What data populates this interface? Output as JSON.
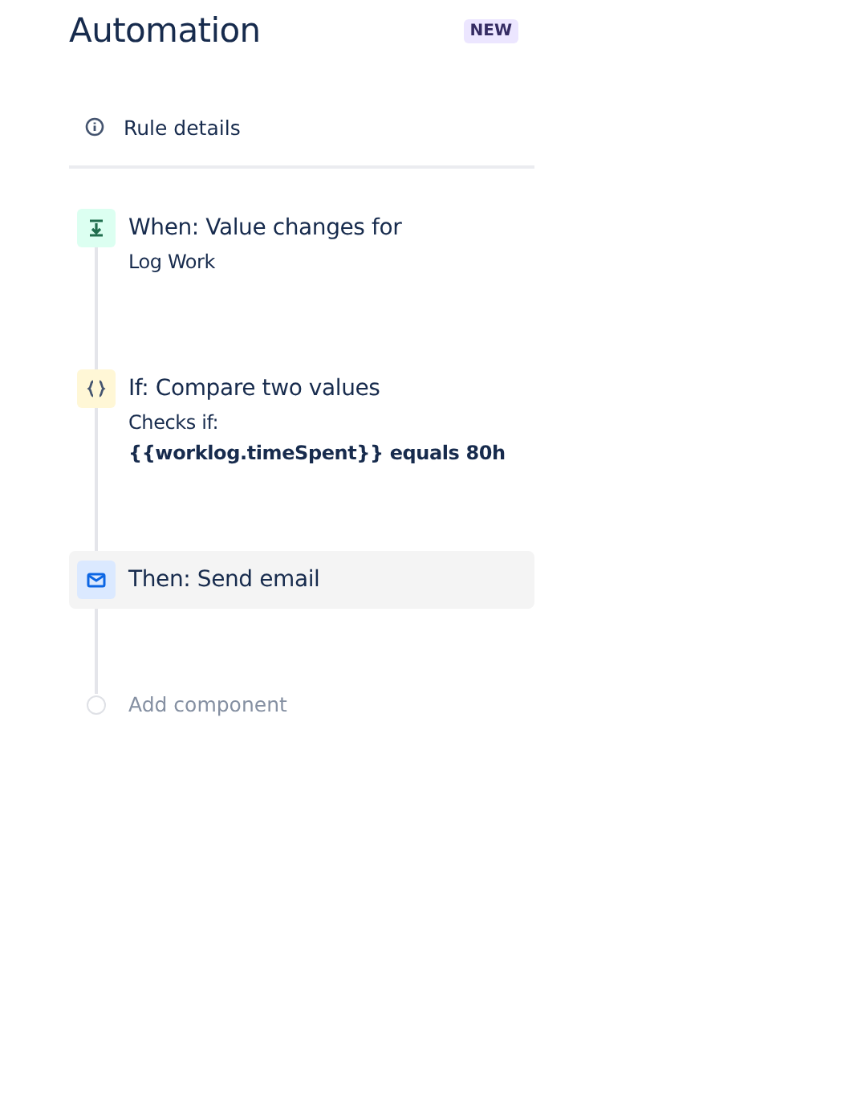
{
  "header": {
    "title": "Automation",
    "badge": "NEW"
  },
  "rule_details": {
    "label": "Rule details"
  },
  "steps": [
    {
      "kind": "trigger",
      "title": "When: Value changes for",
      "selected": false,
      "details": [
        {
          "text": "Log Work",
          "emphasis": false
        }
      ]
    },
    {
      "kind": "condition",
      "title": "If: Compare two values",
      "selected": false,
      "details": [
        {
          "text": "Checks if:",
          "emphasis": false
        },
        {
          "text": "{{worklog.timeSpent}} equals 80h",
          "emphasis": true
        }
      ]
    },
    {
      "kind": "action",
      "title": "Then: Send email",
      "selected": true
    }
  ],
  "add_component": {
    "label": "Add component"
  }
}
